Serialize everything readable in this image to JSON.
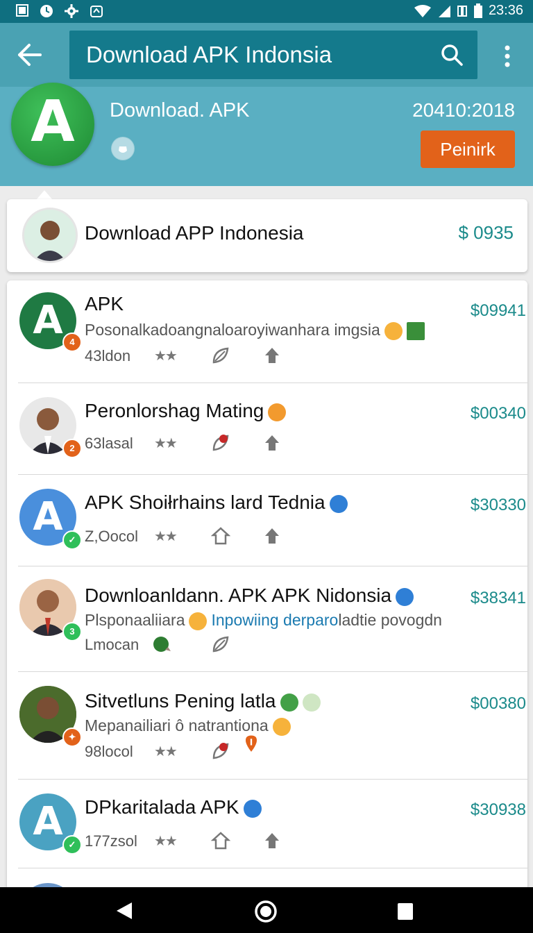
{
  "status_bar": {
    "time": "23:36"
  },
  "app_bar": {
    "search_title": "Download APK Indonsia"
  },
  "header": {
    "logo_letter": "A",
    "title": "Download. APK",
    "date": "20410:2018",
    "button_label": "Peinirk"
  },
  "featured": {
    "title": "Download APP Indonesia",
    "price": "$ 0935"
  },
  "list": [
    {
      "letter": "A",
      "title": "APK",
      "subtitle": "Posonalkadoangnaloarοyiwanhara imgsia",
      "meta": "43ldon",
      "price": "$09941",
      "badge": "4"
    },
    {
      "title": "Peronlorshag Mating",
      "meta": "63lasal",
      "price": "$00340",
      "badge": "2"
    },
    {
      "letter": "A",
      "title": "APK Shoiłrhains lard Tednia",
      "meta": "Z,Oocol",
      "price": "$30330",
      "badge": "✓"
    },
    {
      "title": "Downloanldann. APK APK Nidonsia",
      "subtitle": "Plsponaaliiara",
      "subtitle_link": "Inpowiing derparo",
      "subtitle_tail": "ladtie povogdn",
      "meta": "Lmocan",
      "price": "$38341",
      "badge": "3"
    },
    {
      "title": "Sitvetluns Pening latla",
      "subtitle": "Mepanailiari ô natrantiona",
      "meta": "98locol",
      "price": "$00380",
      "badge": "✦"
    },
    {
      "letter": "A",
      "title": "DPkaritalada APK",
      "meta": "177zsol",
      "price": "$30938",
      "badge": "✓"
    }
  ],
  "colors": {
    "primary": "#4aa2b3",
    "status": "#0f6f80",
    "accent": "#e2621a",
    "price": "#1a8a8a"
  }
}
